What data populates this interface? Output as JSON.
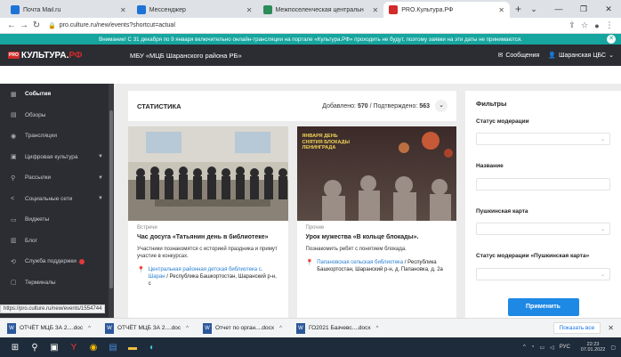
{
  "browser": {
    "tabs": [
      {
        "title": "Почта Mail.ru",
        "color": "#1e73d6",
        "active": false
      },
      {
        "title": "Мессенджер",
        "color": "#1e73d6",
        "active": false
      },
      {
        "title": "Межпоселенческая центральн",
        "color": "#2c8c5a",
        "active": false
      },
      {
        "title": "PRO.Культура.РФ",
        "color": "#d12b2b",
        "active": true
      }
    ],
    "url": "pro.culture.ru/new/events?shortcut=actual"
  },
  "notice": "Внимание! С 31 декабря по 9 января включительно онлайн-трансляции на портале «Культура.РФ» проходить не будут, поэтому заявки на эти даты не принимаются.",
  "header": {
    "logo_pro": "PRO",
    "logo_main": "КУЛЬТУРА.",
    "logo_rf": "РФ",
    "org": "МБУ «МЦБ Шаранского района РБ»",
    "messages": "Сообщения",
    "user": "Шаранская ЦБС"
  },
  "sidebar": {
    "items": [
      {
        "label": "События",
        "icon": "calendar-icon",
        "active": true
      },
      {
        "label": "Обзоры",
        "icon": "review-icon"
      },
      {
        "label": "Трансляции",
        "icon": "broadcast-icon"
      },
      {
        "label": "Цифровая культура",
        "icon": "digital-icon",
        "chevron": true
      },
      {
        "label": "Рассылки",
        "icon": "mail-icon",
        "chevron": true
      },
      {
        "label": "Социальные сети",
        "icon": "share-icon",
        "chevron": true
      },
      {
        "label": "Виджеты",
        "icon": "widget-icon"
      },
      {
        "label": "Блог",
        "icon": "blog-icon"
      },
      {
        "label": "Служба поддержки",
        "icon": "support-icon",
        "badge": true
      },
      {
        "label": "Терминалы",
        "icon": "terminal-icon"
      }
    ]
  },
  "stats": {
    "title": "СТАТИСТИКА",
    "added_label": "Добавлено:",
    "added_value": "570",
    "separator": "/",
    "confirmed_label": "Подтверждено:",
    "confirmed_value": "563"
  },
  "cards": [
    {
      "category": "Встречи",
      "title": "Час досуга «Татьянин день в библиотеке»",
      "description": "Участники познакомятся с историей праздника и примут участие в конкурсах.",
      "location_link": "Центральная районная детская библиотека с. Шаран",
      "location_text": " / Республика Башкортостан, Шаранский р-н, с"
    },
    {
      "category": "Прочие",
      "title": "Урок мужества «В кольце блокады».",
      "description": "Познакомить ребят с понятием блокада.",
      "image_caption": "ЯНВАРЯ ДЕНЬ СНЯТИЯ БЛОКАДЫ ЛЕНИНГРАДА",
      "location_link": "Папановская сельская библиотека",
      "location_text": " / Республика Башкортостан, Шаранский р-н, д. Папановка, д. 2а"
    }
  ],
  "filters": {
    "title": "Фильтры",
    "fields": [
      {
        "label": "Статус модерации",
        "type": "select"
      },
      {
        "label": "Название",
        "type": "input"
      },
      {
        "label": "Пушкинская карта",
        "type": "select"
      },
      {
        "label": "Статус модерации «Пушкинская карта»",
        "type": "select"
      }
    ],
    "apply": "Применить"
  },
  "status_url": "https://pro.culture.ru/new/events/1554744",
  "downloads": [
    {
      "name": "ОТЧЁТ МЦБ ЗА 2....doc"
    },
    {
      "name": "ОТЧЁТ МЦБ ЗА 2....doc"
    },
    {
      "name": "Отчет по орган....docx"
    },
    {
      "name": "ГО2021 Базчевс....docx"
    }
  ],
  "downloads_show_all": "Показать все",
  "taskbar": {
    "lang": "РУС",
    "time": "22:23",
    "date": "07.01.2022"
  }
}
